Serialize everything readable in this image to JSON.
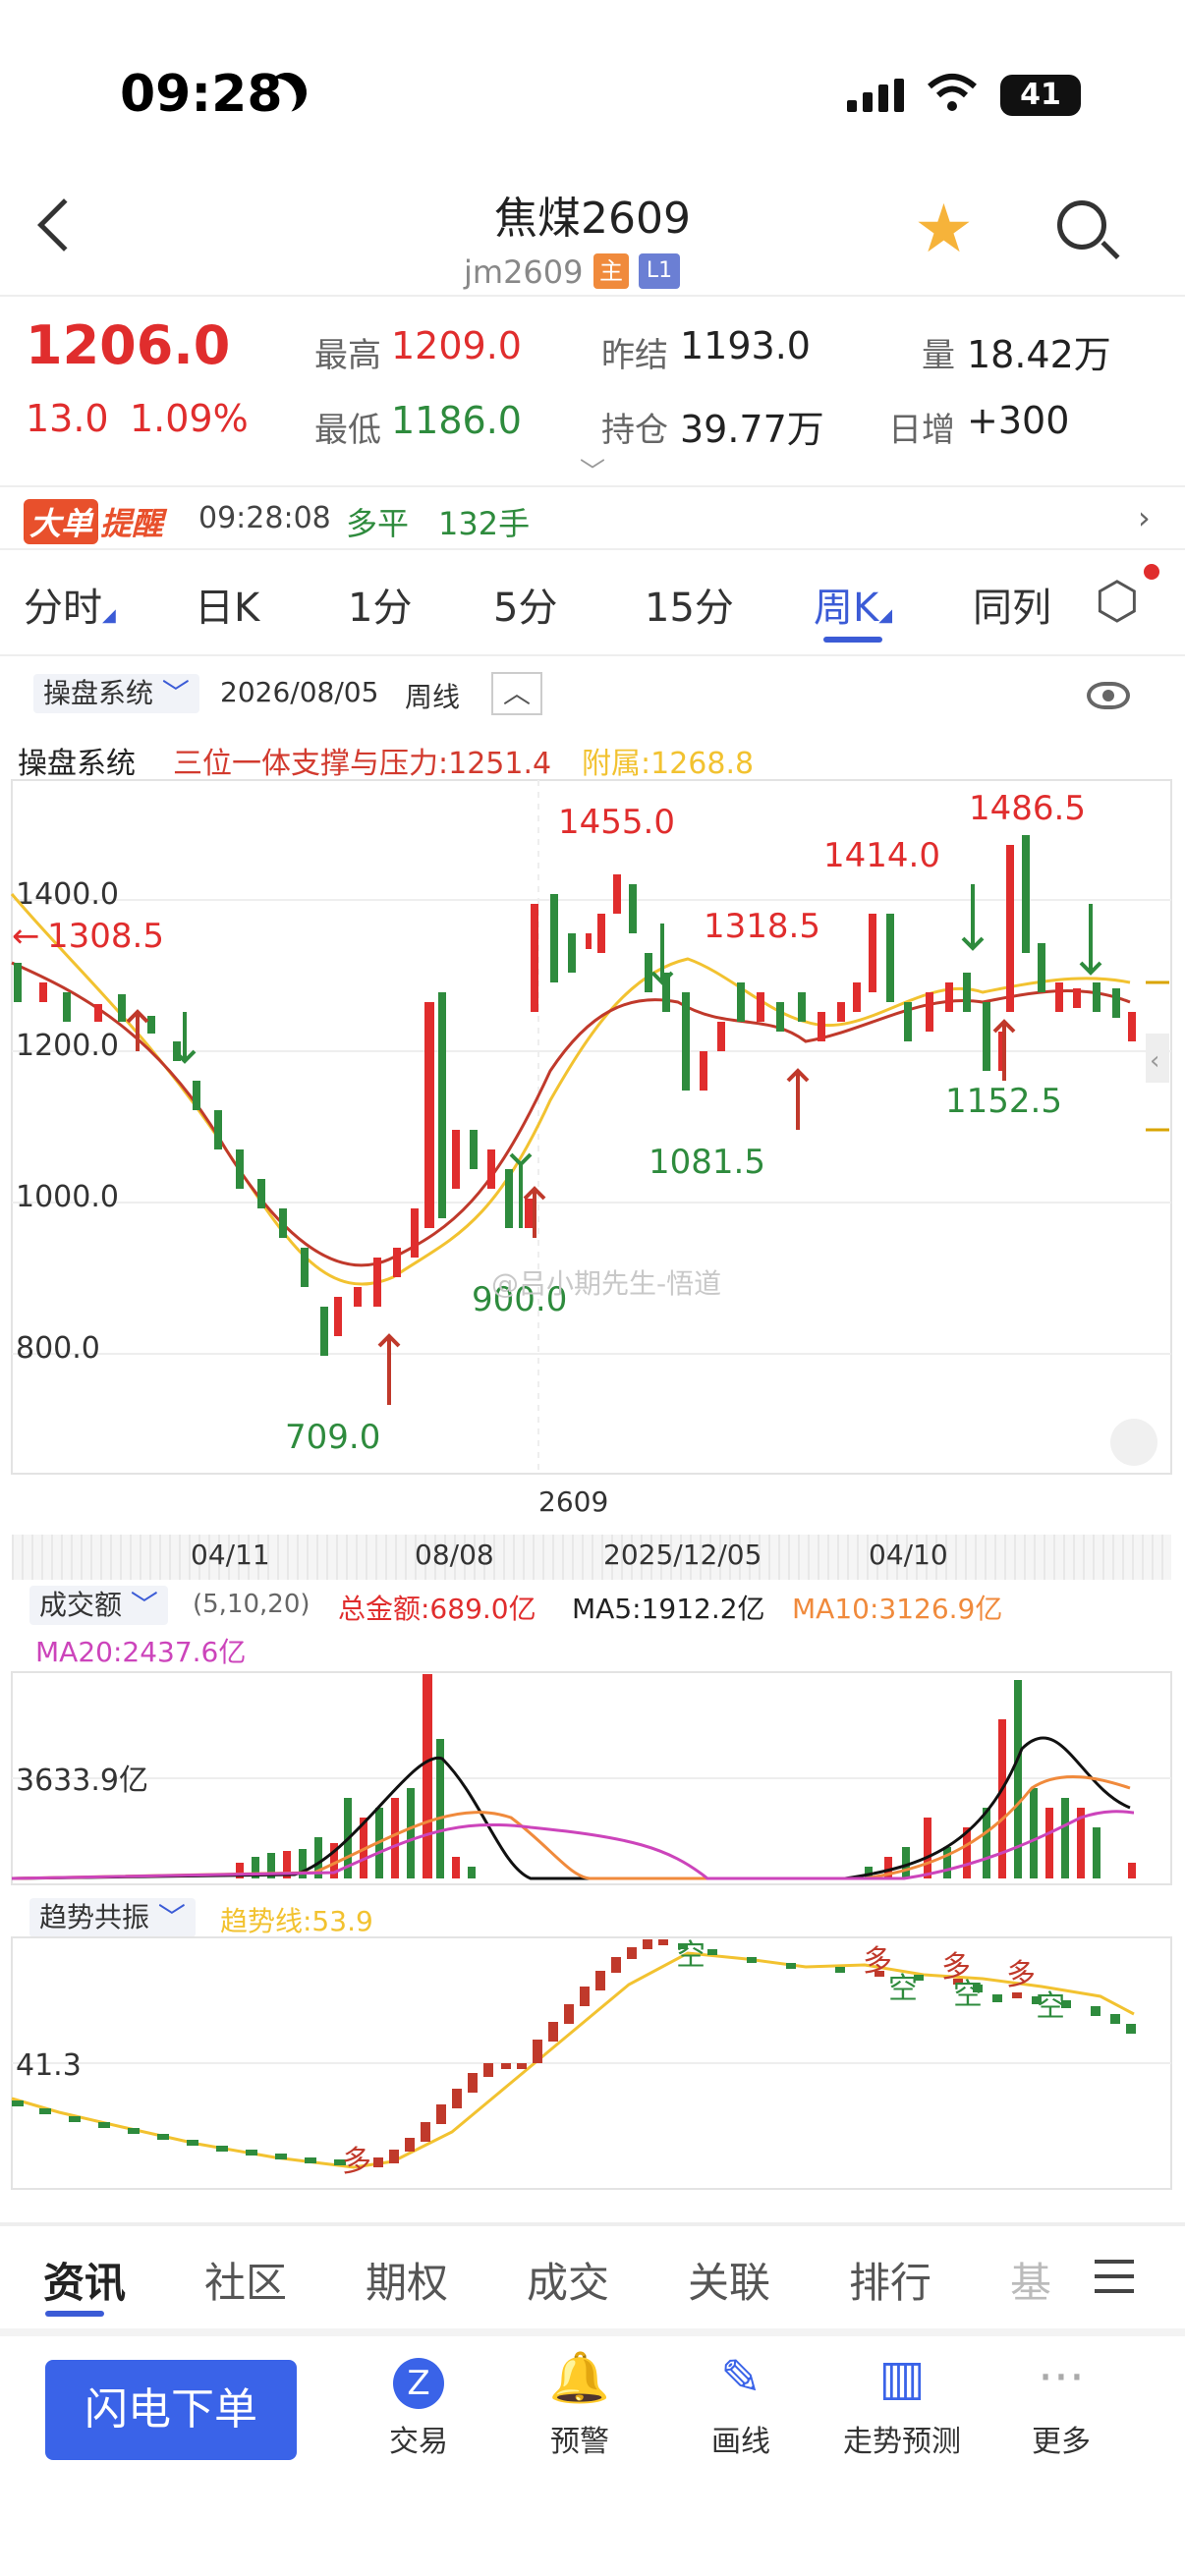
{
  "status_bar": {
    "time": "09:28",
    "battery": "41"
  },
  "header": {
    "title": "焦煤2609",
    "code": "jm2609",
    "tag_main": "主",
    "tag_level": "L1"
  },
  "quote": {
    "price": "1206.0",
    "change": "13.0",
    "change_pct": "1.09%",
    "high_label": "最高",
    "high": "1209.0",
    "low_label": "最低",
    "low": "1186.0",
    "prev_settle_label": "昨结",
    "prev_settle": "1193.0",
    "open_interest_label": "持仓",
    "open_interest": "39.77万",
    "volume_label": "量",
    "volume": "18.42万",
    "daily_incr_label": "日增",
    "daily_incr": "+300"
  },
  "big_order": {
    "badge": "大单",
    "label": "提醒",
    "time": "09:28:08",
    "direction": "多平",
    "qty": "132手"
  },
  "tabs": [
    {
      "label": "分时"
    },
    {
      "label": "日K"
    },
    {
      "label": "1分"
    },
    {
      "label": "5分"
    },
    {
      "label": "15分"
    },
    {
      "label": "周K"
    },
    {
      "label": "同列"
    }
  ],
  "indicator_bar": {
    "system": "操盘系统",
    "date": "2026/08/05",
    "period": "周线"
  },
  "indicator_line": {
    "name": "操盘系统",
    "pressure": "三位一体支撑与压力:1251.4",
    "attach": "附属:1268.8"
  },
  "main_chart": {
    "y_labels": [
      "1400.0",
      "1200.0",
      "1000.0",
      "800.0"
    ],
    "annotations": [
      "1455.0",
      "1486.5",
      "1414.0",
      "1318.5",
      "1308.5",
      "1152.5",
      "1081.5",
      "900.0",
      "709.0"
    ],
    "watermark": "@吕小期先生-悟道",
    "contract_mark": "2609",
    "x_labels": [
      "04/11",
      "08/08",
      "2025/12/05",
      "04/10"
    ]
  },
  "volume_panel": {
    "name": "成交额",
    "params": "(5,10,20)",
    "total": "总金额:689.0亿",
    "ma5": "MA5:1912.2亿",
    "ma10": "MA10:3126.9亿",
    "ma20": "MA20:2437.6亿",
    "y_label": "3633.9亿"
  },
  "trend_panel": {
    "name": "趋势共振",
    "line": "趋势线:53.9",
    "y_label": "41.3",
    "long_mark": "多",
    "short_mark": "空"
  },
  "bottom_tabs": [
    {
      "label": "资讯"
    },
    {
      "label": "社区"
    },
    {
      "label": "期权"
    },
    {
      "label": "成交"
    },
    {
      "label": "关联"
    },
    {
      "label": "排行"
    },
    {
      "label": "基"
    }
  ],
  "actions": {
    "order_button": "闪电下单",
    "items": [
      {
        "label": "交易",
        "icon": "trade-icon"
      },
      {
        "label": "预警",
        "icon": "bell-icon"
      },
      {
        "label": "画线",
        "icon": "pen-icon"
      },
      {
        "label": "走势预测",
        "icon": "book-icon"
      },
      {
        "label": "更多",
        "icon": "more-icon"
      }
    ]
  },
  "colors": {
    "up": "#e02d2d",
    "down": "#2e8b3d",
    "ma_yellow": "#f2c230",
    "ma_red": "#c0392b",
    "accent": "#3b5bd6"
  }
}
